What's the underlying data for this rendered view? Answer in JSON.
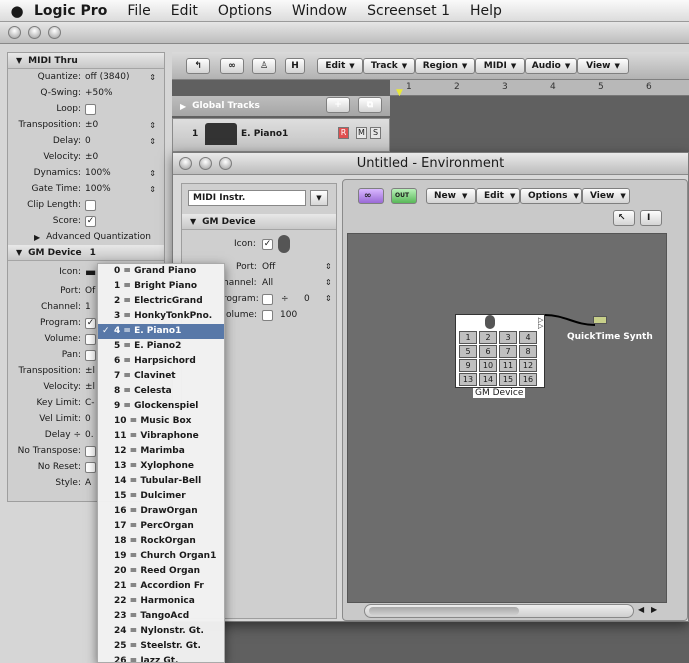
{
  "menubar": {
    "apple": "",
    "items": [
      "Logic Pro",
      "File",
      "Edit",
      "Options",
      "Window",
      "Screenset 1",
      "Help"
    ]
  },
  "inspector": {
    "midi_thru": {
      "title": "MIDI Thru",
      "rows": [
        {
          "label": "Quantize:",
          "value": "off (3840)"
        },
        {
          "label": "Q-Swing:",
          "value": "+50%"
        },
        {
          "label": "Loop:",
          "value": ""
        },
        {
          "label": "Transposition:",
          "value": "±0"
        },
        {
          "label": "Delay:",
          "value": "0"
        },
        {
          "label": "Velocity:",
          "value": "±0"
        },
        {
          "label": "Dynamics:",
          "value": "100%"
        },
        {
          "label": "Gate Time:",
          "value": "100%"
        },
        {
          "label": "Clip Length:",
          "value": ""
        },
        {
          "label": "Score:",
          "value": "✓"
        }
      ],
      "advanced": "Advanced Quantization"
    },
    "gm_device": {
      "title": "GM Device",
      "count": "1",
      "rows": [
        {
          "label": "Icon:",
          "value": ""
        },
        {
          "label": "Port:",
          "value": "Of"
        },
        {
          "label": "Channel:",
          "value": "1"
        },
        {
          "label": "Program:",
          "value": ""
        },
        {
          "label": "Volume:",
          "value": ""
        },
        {
          "label": "Pan:",
          "value": ""
        },
        {
          "label": "Transposition:",
          "value": "±l"
        },
        {
          "label": "Velocity:",
          "value": "±l"
        },
        {
          "label": "Key Limit:",
          "value": "C-"
        },
        {
          "label": "Vel Limit:",
          "value": "0"
        },
        {
          "label": "Delay ÷",
          "value": "0."
        },
        {
          "label": "No Transpose:",
          "value": ""
        },
        {
          "label": "No Reset:",
          "value": ""
        },
        {
          "label": "Style:",
          "value": "A"
        }
      ]
    }
  },
  "arrange": {
    "toolbar": [
      "Edit",
      "Track",
      "Region",
      "MIDI",
      "Audio",
      "View"
    ],
    "tool_h": "H",
    "ruler": [
      "1",
      "2",
      "3",
      "4",
      "5",
      "6"
    ],
    "global_tracks": "Global Tracks",
    "track": {
      "number": "1",
      "name": "E. Piano1",
      "r": "R",
      "m": "M",
      "s": "S"
    }
  },
  "environment": {
    "title": "Untitled - Environment",
    "layer": "MIDI Instr.",
    "menus": [
      "New",
      "Edit",
      "Options",
      "View"
    ],
    "gm_section": "GM Device",
    "fields": [
      {
        "label": "Icon:",
        "value": ""
      },
      {
        "label": "Port:",
        "value": "Off"
      },
      {
        "label": "Channel:",
        "value": "All"
      },
      {
        "label": "Program:",
        "value": "0"
      },
      {
        "label": "Volume:",
        "value": "100"
      }
    ],
    "channel_label": "hannel:",
    "program_label": "rogram:",
    "volume_label": "olume:",
    "program_sep": "÷",
    "device_name": "GM Device",
    "pads": [
      "1",
      "2",
      "3",
      "4",
      "5",
      "6",
      "7",
      "8",
      "9",
      "10",
      "11",
      "12",
      "13",
      "14",
      "15",
      "16"
    ],
    "synth_name": "QuickTime Synth",
    "out_label": "OUT"
  },
  "popup": {
    "selected_index": 4,
    "items": [
      "0 = Grand Piano",
      "1 = Bright Piano",
      "2 = ElectricGrand",
      "3 = HonkyTonkPno.",
      "4 = E. Piano1",
      "5 = E. Piano2",
      "6 = Harpsichord",
      "7 = Clavinet",
      "8 = Celesta",
      "9 = Glockenspiel",
      "10 = Music Box",
      "11 = Vibraphone",
      "12 = Marimba",
      "13 = Xylophone",
      "14 = Tubular-Bell",
      "15 = Dulcimer",
      "16 = DrawOrgan",
      "17 = PercOrgan",
      "18 = RockOrgan",
      "19 = Church Organ1",
      "20 = Reed Organ",
      "21 = Accordion Fr",
      "22 = Harmonica",
      "23 = TangoAcd",
      "24 = Nylonstr. Gt.",
      "25 = Steelstr. Gt.",
      "26 = Jazz Gt."
    ]
  }
}
